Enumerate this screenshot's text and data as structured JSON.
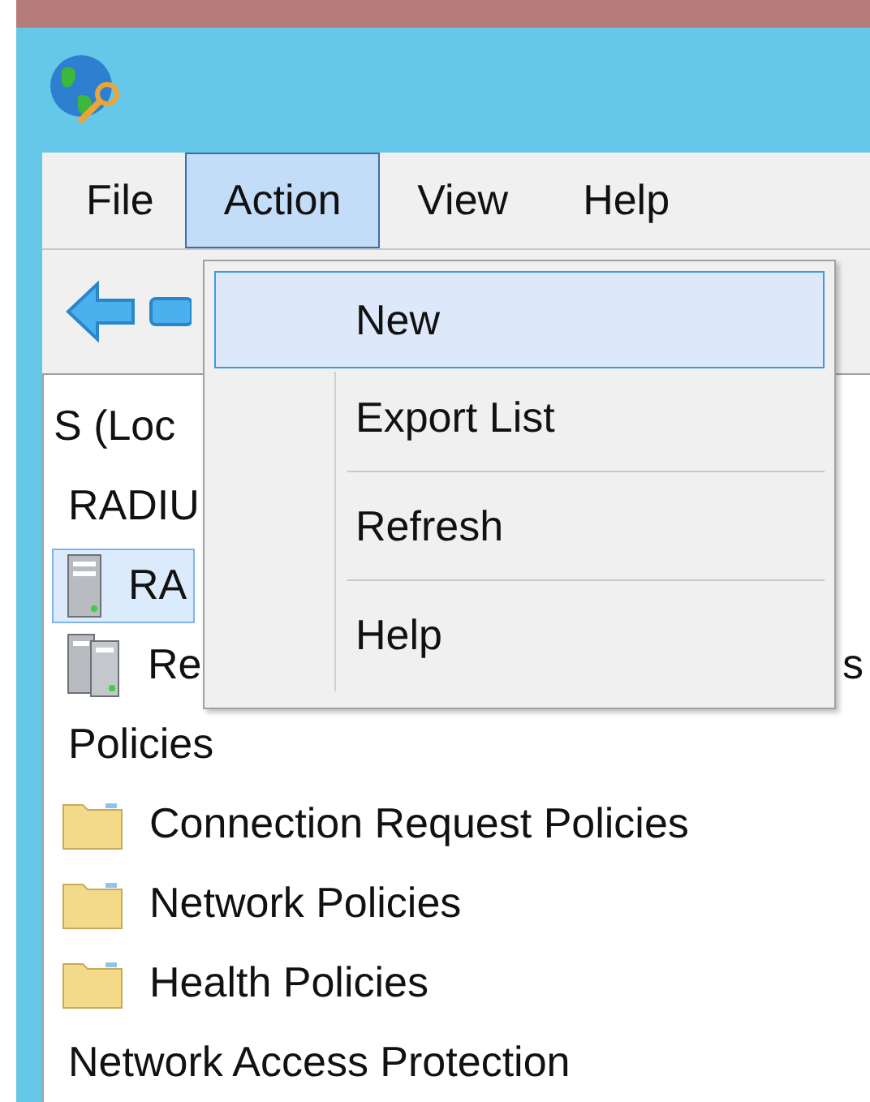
{
  "menu_bar": [
    {
      "label": "File",
      "selected": false
    },
    {
      "label": "Action",
      "selected": true
    },
    {
      "label": "View",
      "selected": false
    },
    {
      "label": "Help",
      "selected": false
    }
  ],
  "dropdown": [
    {
      "kind": "item",
      "label": "New",
      "selected": true
    },
    {
      "kind": "item",
      "label": "Export List",
      "selected": false
    },
    {
      "kind": "separator"
    },
    {
      "kind": "item",
      "label": "Refresh",
      "selected": false
    },
    {
      "kind": "separator"
    },
    {
      "kind": "item",
      "label": "Help",
      "selected": false
    }
  ],
  "tree": {
    "label": "S (Loc",
    "children": [
      {
        "label": "RADIU",
        "children": [
          {
            "label": "RA",
            "kind": "server",
            "selected": true
          },
          {
            "label": "Re",
            "label_end": "s",
            "kind": "server-group",
            "selected": false
          }
        ]
      },
      {
        "label": "Policies",
        "children": [
          {
            "label": "Connection Request Policies",
            "kind": "folder",
            "selected": false
          },
          {
            "label": "Network Policies",
            "kind": "folder",
            "selected": false
          },
          {
            "label": "Health Policies",
            "kind": "folder",
            "selected": false
          }
        ]
      },
      {
        "label": "Network Access Protection"
      }
    ]
  }
}
